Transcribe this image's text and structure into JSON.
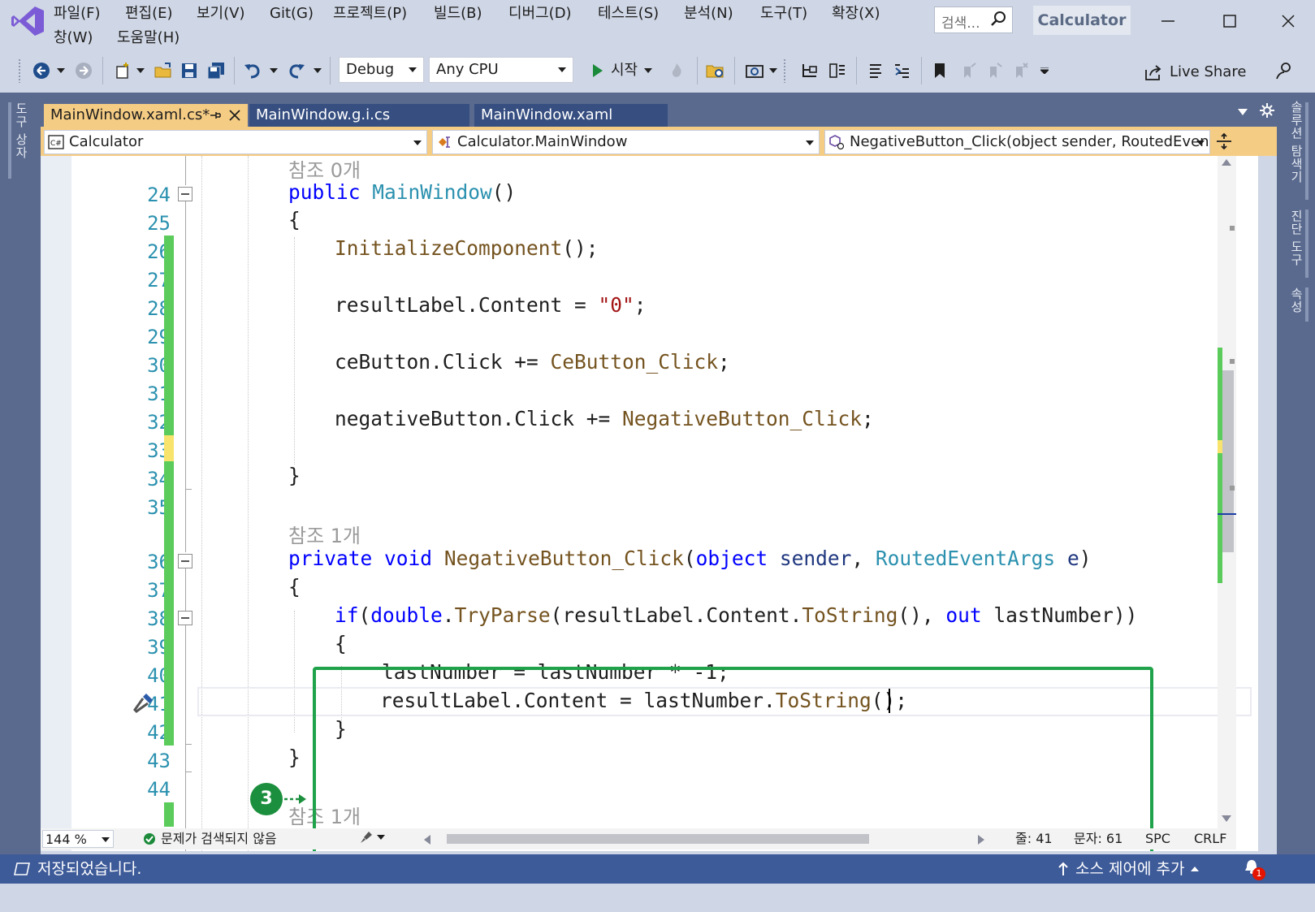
{
  "menu": {
    "items": [
      "파일(F)",
      "편집(E)",
      "보기(V)",
      "Git(G)",
      "프로젝트(P)",
      "빌드(B)",
      "디버그(D)",
      "테스트(S)",
      "분석(N)",
      "도구(T)",
      "확장(X)",
      "창(W)",
      "도움말(H)"
    ],
    "search_placeholder": "검색...",
    "window_title": "Calculator"
  },
  "toolbar": {
    "config": "Debug",
    "platform": "Any CPU",
    "start_label": "시작",
    "live_share_label": "Live Share"
  },
  "side_panels": {
    "left": "도구 상자",
    "right_1": "솔루션 탐색기",
    "right_2": "진단 도구",
    "right_3": "속성"
  },
  "tabs": [
    {
      "label": "MainWindow.xaml.cs*",
      "active": true
    },
    {
      "label": "MainWindow.g.i.cs",
      "active": false
    },
    {
      "label": "MainWindow.xaml",
      "active": false
    }
  ],
  "navbar": {
    "project": "Calculator",
    "type": "Calculator.MainWindow",
    "member": "NegativeButton_Click(object sender, RoutedEventArgs e)"
  },
  "editor": {
    "lens_0": "참조 0개",
    "lens_1": "참조 1개",
    "lens_2": "참조 1개",
    "line_numbers": [
      "24",
      "25",
      "26",
      "27",
      "28",
      "29",
      "30",
      "31",
      "32",
      "33",
      "34",
      "35",
      "36",
      "37",
      "38",
      "39",
      "40",
      "41",
      "42",
      "43",
      "44"
    ],
    "lines": {
      "l24": [
        "public",
        "MainWindow",
        "()"
      ],
      "l25": "{",
      "l26": [
        "InitializeComponent",
        "();"
      ],
      "l28": [
        "resultLabel.Content = ",
        "\"0\"",
        ";"
      ],
      "l30": [
        "ceButton.Click += ",
        "CeButton_Click",
        ";"
      ],
      "l32": [
        "negativeButton.Click += ",
        "NegativeButton_Click",
        ";"
      ],
      "l34": "}",
      "l36": [
        "private",
        "void",
        "NegativeButton_Click",
        "(",
        "object",
        "sender",
        ", ",
        "RoutedEventArgs",
        "e",
        ")"
      ],
      "l37": "{",
      "l38": [
        "if",
        "(",
        "double",
        ".",
        "TryParse",
        "(resultLabel.Content.",
        "ToString",
        "(), ",
        "out",
        " lastNumber))"
      ],
      "l39": "{",
      "l40": "lastNumber = lastNumber * -1;",
      "l41": [
        "resultLabel.Content = lastNumber.",
        "ToString",
        "();"
      ],
      "l42": "}",
      "l43": "}"
    },
    "callout_number": "3"
  },
  "editor_status": {
    "zoom": "144 %",
    "issues": "문제가 검색되지 않음",
    "line": "줄: 41",
    "col": "문자: 61",
    "spc": "SPC",
    "eol": "CRLF"
  },
  "statusbar": {
    "message": "저장되었습니다.",
    "source_control": "소스 제어에 추가",
    "notifications": "1"
  },
  "colors": {
    "accent_tab": "#f5cc84",
    "rail": "#5a6a8e",
    "statusbar": "#3d5a99",
    "highlight": "#1fa24a",
    "change_saved": "#5bcc5b",
    "change_unsaved": "#f8e46c"
  }
}
